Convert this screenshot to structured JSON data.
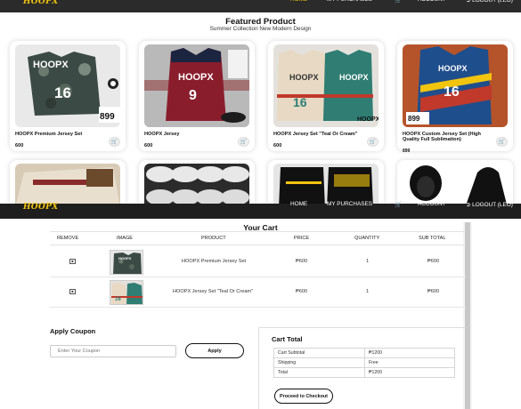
{
  "brand": {
    "logo": "HOOPX"
  },
  "nav": {
    "home": "HOME",
    "purchases": "MY PURCHASES",
    "cart_icon": "cart-icon",
    "account": "ACCOUNT",
    "logout": "LOGOUT (LEO)",
    "logout_icon": "logout-icon",
    "active_color": "#f1c40f"
  },
  "featured": {
    "title": "Featured Product",
    "subtitle": "Summer Collection New Modern Design",
    "products": [
      {
        "name": "HOOPX Premium Jersey Set",
        "price": "600"
      },
      {
        "name": "HOOPX Jersey",
        "price": "600"
      },
      {
        "name": "HOOPX Jersey Set \"Teal Or Cream\"",
        "price": "600"
      },
      {
        "name": "HOOPX Custom Jersey Set (High Quality Full Sublimation)",
        "price": "899"
      }
    ]
  },
  "cart": {
    "title": "Your Cart",
    "headers": {
      "remove": "REMOVE",
      "image": "IMAGE",
      "product": "PRODUCT",
      "price": "PRICE",
      "quantity": "QUANTITY",
      "subtotal": "SUB TOTAL"
    },
    "rows": [
      {
        "product": "HOOPX Premium Jersey Set",
        "price": "₱600",
        "quantity": "1",
        "subtotal": "₱600"
      },
      {
        "product": "HOOPX Jersey Set \"Teal Or Cream\"",
        "price": "₱600",
        "quantity": "1",
        "subtotal": "₱600"
      }
    ]
  },
  "coupon": {
    "title": "Apply Coupon",
    "placeholder": "Enter Your Coupon",
    "button": "Apply"
  },
  "totals": {
    "title": "Cart Total",
    "subtotal_label": "Cart Subtotal",
    "subtotal_value": "₱1200",
    "shipping_label": "Shipping",
    "shipping_value": "Free",
    "total_label": "Total",
    "total_value": "₱1200",
    "checkout": "Proceed to Checkout"
  }
}
